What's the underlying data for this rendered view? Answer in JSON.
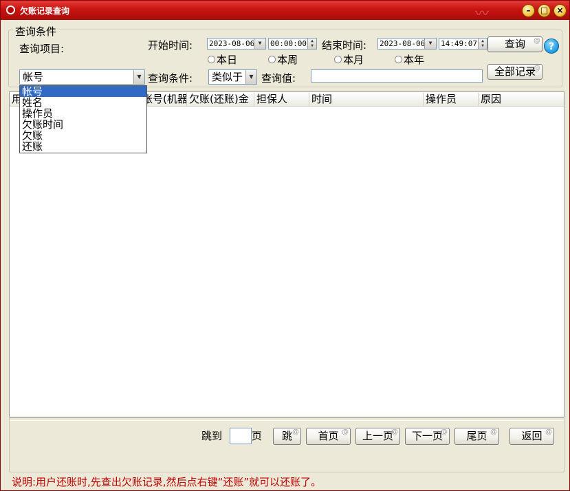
{
  "window": {
    "title": "欠账记录查询"
  },
  "filter": {
    "group_title": "查询条件",
    "field_label": "查询项目:",
    "start_label": "开始时间:",
    "start_date": "2023-08-06",
    "start_time": "00:00:00",
    "end_label": "结束时间:",
    "end_date": "2023-08-06",
    "end_time": "14:49:07",
    "radios": [
      "本日",
      "本周",
      "本月",
      "本年"
    ],
    "query_button": "查询",
    "all_records_button": "全部记录",
    "field_selected": "帐号",
    "condition_label": "查询条件:",
    "condition_value": "类似于",
    "value_label": "查询值:",
    "value_text": ""
  },
  "dropdown": {
    "options": [
      "帐号",
      "姓名",
      "操作员",
      "欠账时间",
      "欠账",
      "还账"
    ],
    "selected_index": 0
  },
  "grid": {
    "columns": [
      "用",
      "帐号(机器",
      "欠账(还账)金",
      "担保人",
      "时间",
      "操作员",
      "原因"
    ]
  },
  "pager": {
    "jump_label": "跳到",
    "page_unit": "页",
    "jump_button": "跳",
    "first_button": "首页",
    "prev_button": "上一页",
    "next_button": "下一页",
    "last_button": "尾页",
    "back_button": "返回"
  },
  "status": {
    "text": "说明:用户还账时,先查出欠账记录,然后点右键“还账”就可以还账了。"
  },
  "colors": {
    "title_bar": "#c81410",
    "selection": "#316ac5",
    "status_text": "#c00000"
  }
}
